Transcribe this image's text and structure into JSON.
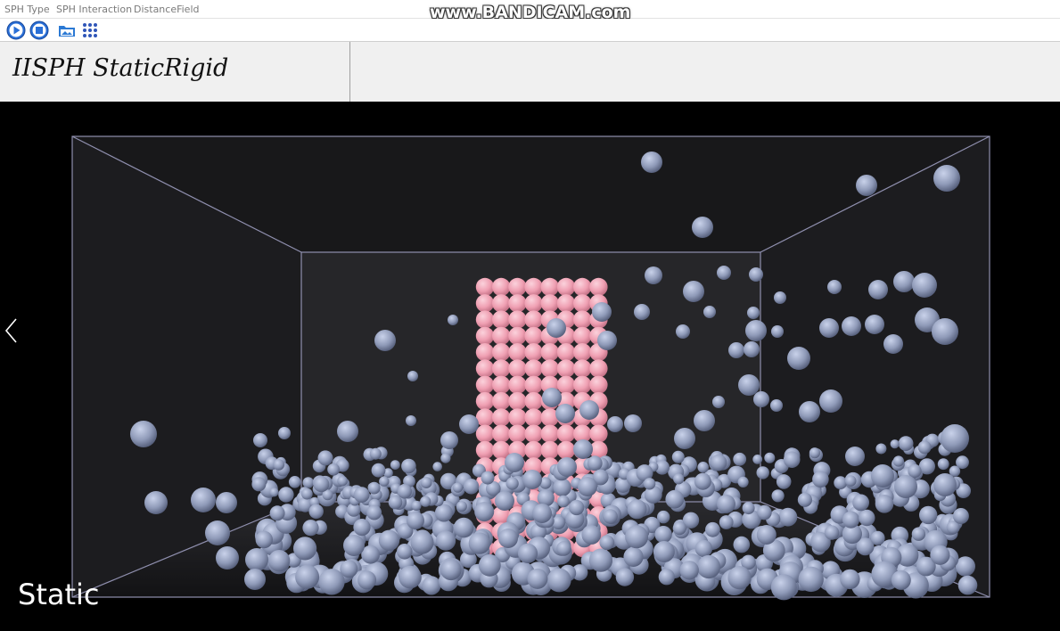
{
  "menu": {
    "items": [
      {
        "label": "SPH Type"
      },
      {
        "label": "SPH Interaction"
      },
      {
        "label": "DistanceField"
      }
    ]
  },
  "watermark": "www.BANDICAM.com",
  "toolbar": {
    "buttons": [
      {
        "icon": "play-icon"
      },
      {
        "icon": "stop-icon"
      },
      {
        "icon": "folder-image-icon"
      },
      {
        "icon": "particle-grid-icon"
      }
    ]
  },
  "title": "IISPH StaticRigid",
  "viewport": {
    "nav_icon": "chevron-left-icon",
    "status": "Static"
  },
  "colors": {
    "fluid_particle": "#8f9ab8",
    "rigid_particle": "#f0a8b8",
    "box_edge": "#8f8fae",
    "background": "#000000"
  }
}
